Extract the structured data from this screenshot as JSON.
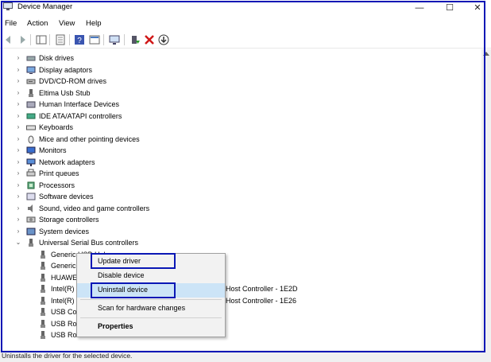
{
  "window": {
    "title": "Device Manager",
    "minimize_glyph": "—",
    "maximize_glyph": "☐",
    "close_glyph": "✕"
  },
  "menu": [
    "File",
    "Action",
    "View",
    "Help"
  ],
  "toolbar": {
    "icons": [
      "back-arrow-icon",
      "forward-arrow-icon",
      "show-hide-console-tree-icon",
      "properties-icon",
      "help-icon",
      "view-icon",
      "monitor-icon",
      "update-driver-icon",
      "uninstall-icon",
      "download-icon"
    ]
  },
  "tree": {
    "categories": [
      {
        "label": "Disk drives",
        "icon": "disk-drive-icon"
      },
      {
        "label": "Display adaptors",
        "icon": "display-adapter-icon"
      },
      {
        "label": "DVD/CD-ROM drives",
        "icon": "dvd-drive-icon"
      },
      {
        "label": "Eltima Usb Stub",
        "icon": "usb-icon"
      },
      {
        "label": "Human Interface Devices",
        "icon": "hid-icon"
      },
      {
        "label": "IDE ATA/ATAPI controllers",
        "icon": "ide-controller-icon"
      },
      {
        "label": "Keyboards",
        "icon": "keyboard-icon"
      },
      {
        "label": "Mice and other pointing devices",
        "icon": "mouse-icon"
      },
      {
        "label": "Monitors",
        "icon": "monitor-icon"
      },
      {
        "label": "Network adapters",
        "icon": "network-adapter-icon"
      },
      {
        "label": "Print queues",
        "icon": "printer-icon"
      },
      {
        "label": "Processors",
        "icon": "processor-icon"
      },
      {
        "label": "Software devices",
        "icon": "software-device-icon"
      },
      {
        "label": "Sound, video and game controllers",
        "icon": "sound-icon"
      },
      {
        "label": "Storage controllers",
        "icon": "storage-controller-icon"
      },
      {
        "label": "System devices",
        "icon": "system-device-icon"
      },
      {
        "label": "Universal Serial Bus controllers",
        "icon": "usb-icon"
      }
    ],
    "usb_children": [
      {
        "label": "Generic USB Hub",
        "suffix": ""
      },
      {
        "label": "Generic",
        "suffix": ""
      },
      {
        "label": "HUAWE",
        "suffix": ""
      },
      {
        "label": "Intel(R)",
        "suffix": "Host Controller - 1E2D"
      },
      {
        "label": "Intel(R)",
        "suffix": "Host Controller - 1E26"
      },
      {
        "label": "USB Co",
        "suffix": ""
      },
      {
        "label": "USB Ro",
        "suffix": ""
      },
      {
        "label": "USB Ro",
        "suffix": ""
      }
    ]
  },
  "context_menu": {
    "update_driver": "Update driver",
    "disable_device": "Disable device",
    "uninstall_device": "Uninstall device",
    "scan_hardware": "Scan for hardware changes",
    "properties": "Properties"
  },
  "status": "Uninstalls the driver for the selected device.",
  "colors": {
    "annotation_blue": "#0a17b5",
    "highlight": "#cce4f7"
  }
}
